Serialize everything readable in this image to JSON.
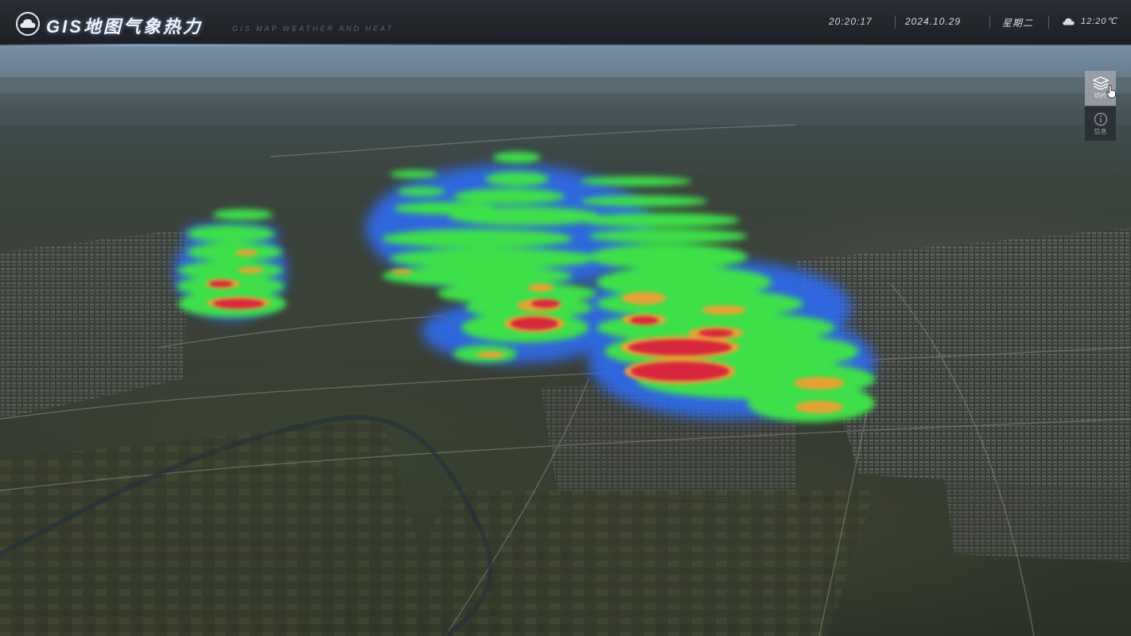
{
  "header": {
    "title": "GIS地图气象热力",
    "subtitle": "GIS MAP WEATHER AND HEAT",
    "time": "20:20:17",
    "date": "2024.10.29",
    "weekday": "星期二",
    "weather_icon": "cloud-icon",
    "temperature": "12:20℃"
  },
  "tools": [
    {
      "label": "切片",
      "icon": "layers-icon",
      "active": true
    },
    {
      "label": "信息",
      "icon": "info-icon",
      "active": false
    }
  ],
  "colors": {
    "header_bg": "#1d1f24",
    "heat_low": "#2f6cf0",
    "heat_mid": "#3ee04a",
    "heat_high": "#f0a030",
    "heat_peak": "#d8283c"
  }
}
